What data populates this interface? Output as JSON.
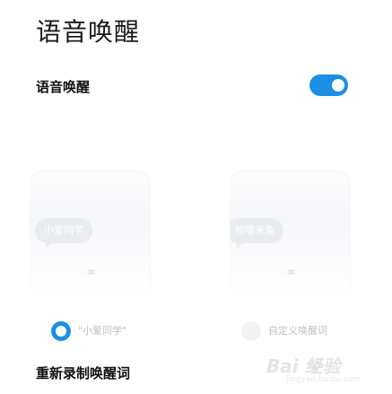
{
  "page": {
    "title": "语音唤醒"
  },
  "setting": {
    "label": "语音唤醒",
    "enabled": true
  },
  "colors": {
    "accent": "#1b8fe6",
    "text": "#111111",
    "muted": "#c0c0c4"
  },
  "wake_options": [
    {
      "bubble": "小爱同学",
      "radio_label": "\"小爱同学\"",
      "selected": true,
      "icon": "infinity-loop-icon"
    },
    {
      "bubble": "哈喽米兔",
      "radio_label": "自定义唤醒词",
      "selected": false,
      "icon": "infinity-loop-icon"
    }
  ],
  "retrain": {
    "label": "重新录制唤醒词"
  },
  "watermark": {
    "main": "Bai 经验",
    "sub": "jingyan.baidu.com"
  }
}
